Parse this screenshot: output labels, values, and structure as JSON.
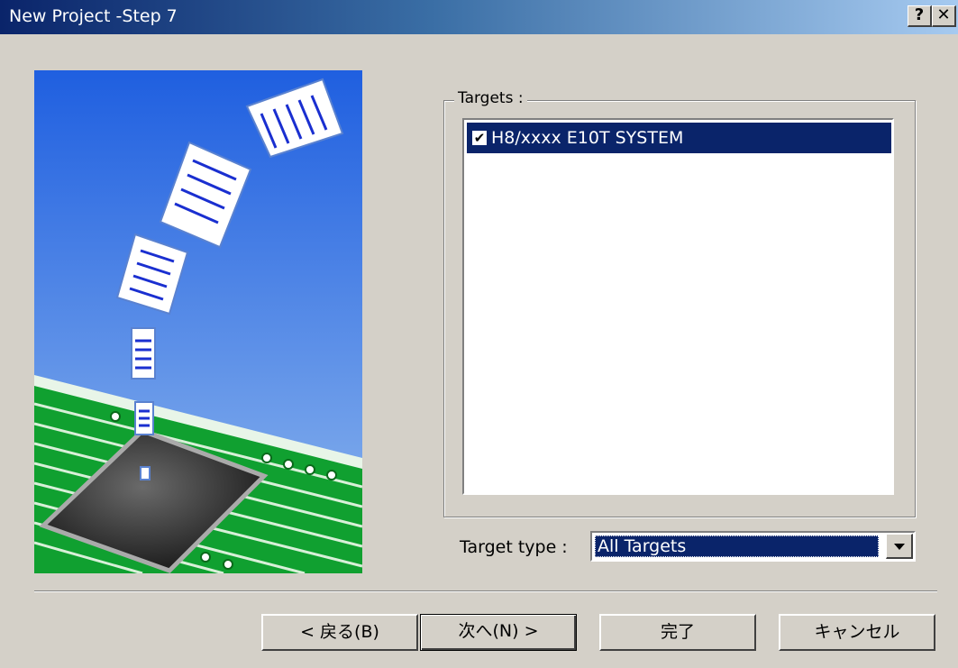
{
  "window": {
    "title": "New Project -Step 7",
    "help_label": "?",
    "close_label": "✕"
  },
  "targets": {
    "group_label": "Targets :",
    "items": [
      {
        "label": "H8/xxxx E10T SYSTEM",
        "checked": true,
        "selected": true
      }
    ]
  },
  "target_type": {
    "label": "Target type :",
    "value": "All Targets"
  },
  "buttons": {
    "back": "< 戻る(B)",
    "next": "次へ(N) >",
    "finish": "完了",
    "cancel": "キャンセル"
  },
  "colors": {
    "selection": "#0a246a",
    "dialog": "#d4d0c8",
    "title_start": "#0a246a",
    "title_end": "#a6caf0"
  }
}
